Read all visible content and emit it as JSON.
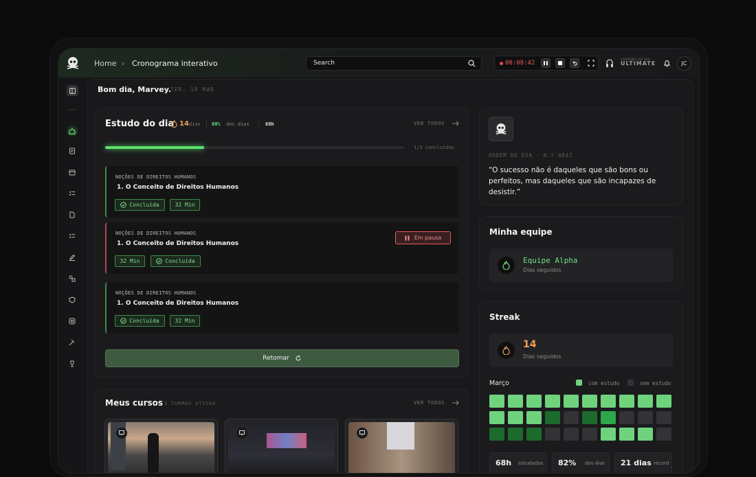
{
  "colors": {
    "accent": "#5fd36f",
    "danger": "#e35a5a",
    "streak": "#f0a050"
  },
  "header": {
    "breadcrumb": [
      "Home",
      "Cronograma interativo"
    ],
    "search_placeholder": "Search",
    "timer": "00:08:42",
    "plan_badge_line1": "CADERNO DO DIA",
    "plan_badge": "ULTIMATE",
    "avatar_initials": "JC"
  },
  "greeting": {
    "text": "Bom dia, Marvey.",
    "date": "TER, 18 MAR"
  },
  "study": {
    "title": "Estudo do dia",
    "streak_days": "14",
    "streak_label": "dias",
    "percent": "80%",
    "percent_label": "dos dias",
    "hours": "68h",
    "view_all": "VER TODOS",
    "progress": 0.33,
    "progress_label": "1/3 concluídas",
    "tasks": [
      {
        "subject": "NOÇÕES DE DIREITOS HUMANOS",
        "title": "1. O Conceito de Direitos Humanos",
        "status": "Concluída",
        "time": "32 Min"
      },
      {
        "subject": "NOÇÕES DE DIREITOS HUMANOS",
        "title": "1. O Conceito de Direitos Humanos",
        "status": "Concluída",
        "time": "32 Min",
        "paused_label": "Em pausa"
      },
      {
        "subject": "NOÇÕES DE DIREITOS HUMANOS",
        "title": "1. O Conceito de Direitos Humanos",
        "status": "Concluída",
        "time": "32 Min"
      }
    ],
    "resume_label": "Retomar"
  },
  "courses": {
    "title": "Meus cursos",
    "subtitle": "3 TURMAS ATIVAS",
    "view_all": "VER TODOS"
  },
  "quote": {
    "meta": "ORDEM DO DIA · N.º 0847",
    "text": "“O sucesso não é daqueles que são bons ou perfeitos, mas daqueles que são incapazes de desistir.”"
  },
  "team": {
    "title": "Minha equipe",
    "name": "Equipe Alpha",
    "sub": "Dias seguidos"
  },
  "streak": {
    "title": "Streak",
    "value": "14",
    "sub": "Dias seguidos",
    "month": "Março",
    "legend_with": "com estudo",
    "legend_without": "sem estudo",
    "grid": [
      3,
      3,
      3,
      3,
      3,
      3,
      3,
      3,
      3,
      3,
      3,
      3,
      3,
      1,
      0,
      1,
      2,
      0,
      0,
      0,
      1,
      1,
      1,
      0,
      0,
      0,
      3,
      3,
      3,
      0
    ],
    "stats": [
      {
        "value": "68h",
        "label": "estudadas"
      },
      {
        "value": "82%",
        "label": "dos dias"
      },
      {
        "value": "21 dias",
        "label": "record"
      }
    ]
  }
}
